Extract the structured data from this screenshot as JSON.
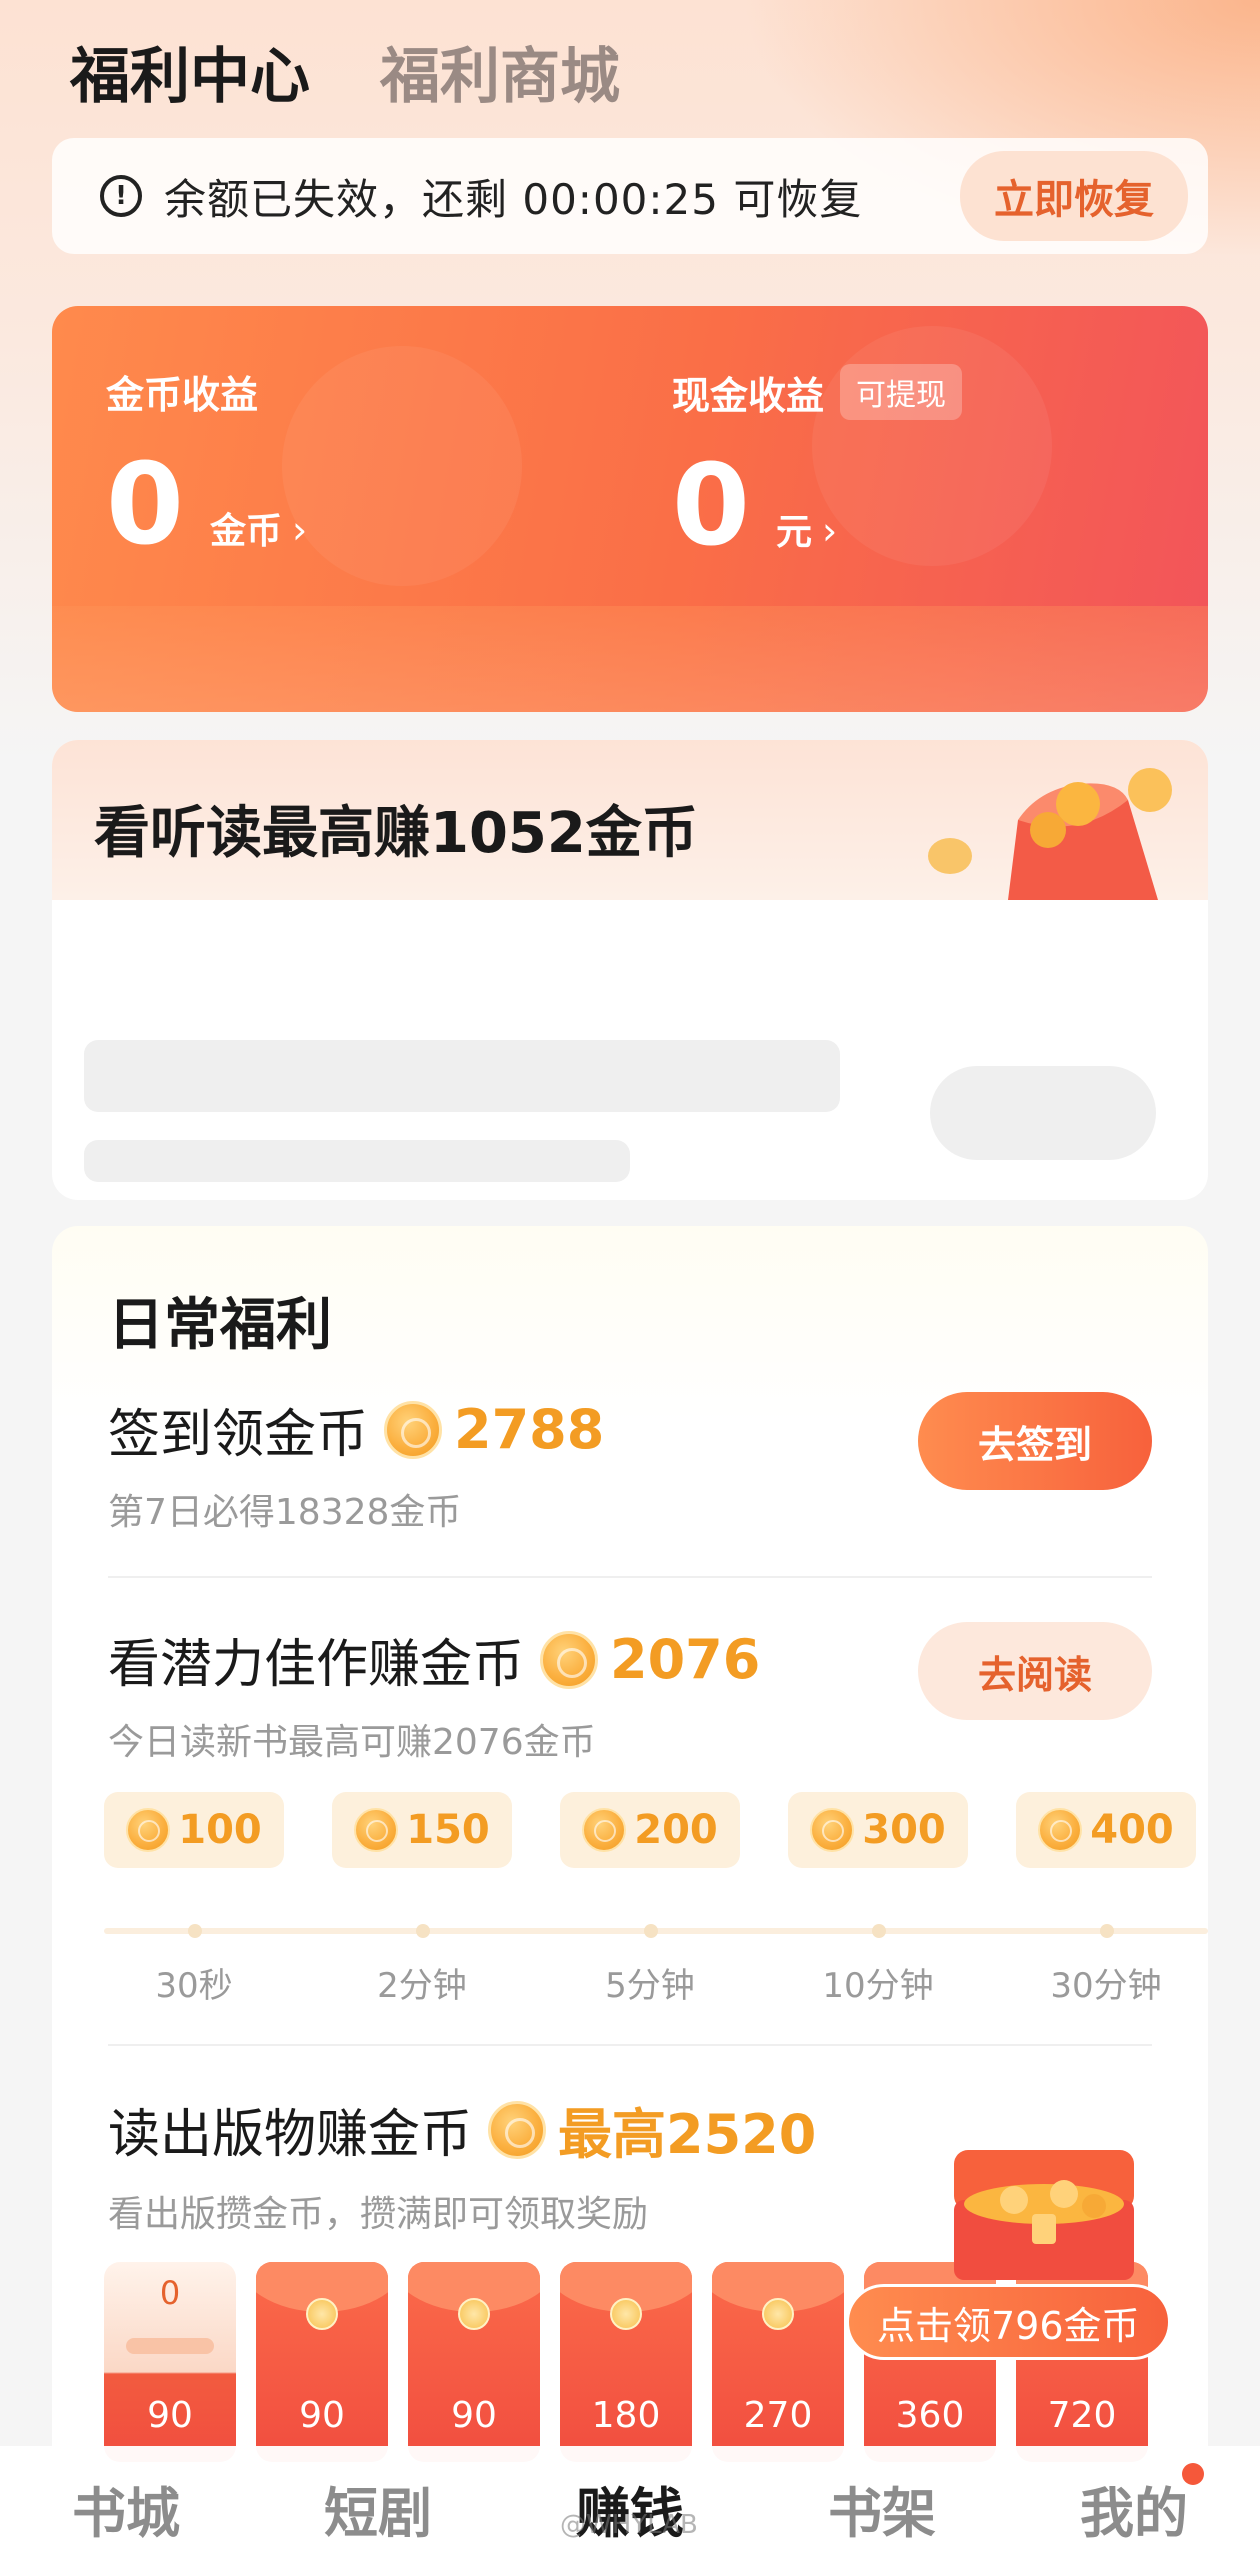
{
  "top_tabs": [
    "福利中心",
    "福利商城"
  ],
  "notice": {
    "icon": "exclamation-circle-icon",
    "text": "余额已失效，还剩 00:00:25 可恢复",
    "button": "立即恢复"
  },
  "earnings": {
    "coin": {
      "label": "金币收益",
      "value": "0",
      "unit": "金币"
    },
    "cash": {
      "label": "现金收益",
      "tag": "可提现",
      "value": "0",
      "unit": "元"
    },
    "chevron": "›"
  },
  "listen": {
    "title": "看听读最高赚1052金币"
  },
  "daily": {
    "title": "日常福利",
    "signin": {
      "title": "签到领金币",
      "amount": "2788",
      "sub": "第7日必得18328金币",
      "button": "去签到"
    },
    "potential": {
      "title": "看潜力佳作赚金币",
      "amount": "2076",
      "sub": "今日读新书最高可赚2076金币",
      "button": "去阅读",
      "milestones": [
        {
          "coins": "100",
          "time": "30秒"
        },
        {
          "coins": "150",
          "time": "2分钟"
        },
        {
          "coins": "200",
          "time": "5分钟"
        },
        {
          "coins": "300",
          "time": "10分钟"
        },
        {
          "coins": "400",
          "time": "30分钟"
        }
      ]
    },
    "publication": {
      "title": "读出版物赚金币",
      "amount": "最高2520",
      "sub": "看出版攒金币，攒满即可领取奖励",
      "first_packet_progress": "0",
      "packets": [
        "90",
        "90",
        "90",
        "180",
        "270",
        "360",
        "720"
      ],
      "claim": "点击领796金币"
    }
  },
  "bottom_nav": [
    {
      "label": "书城",
      "active": false
    },
    {
      "label": "短剧",
      "active": false
    },
    {
      "label": "赚钱",
      "active": true
    },
    {
      "label": "书架",
      "active": false
    },
    {
      "label": "我的",
      "active": false,
      "badge": true
    }
  ],
  "watermark": "@WHYLAB",
  "colors": {
    "accent": "#f7613c",
    "coin": "#f39c23",
    "card_gradient": [
      "#ff8a4c",
      "#f2545a"
    ]
  }
}
